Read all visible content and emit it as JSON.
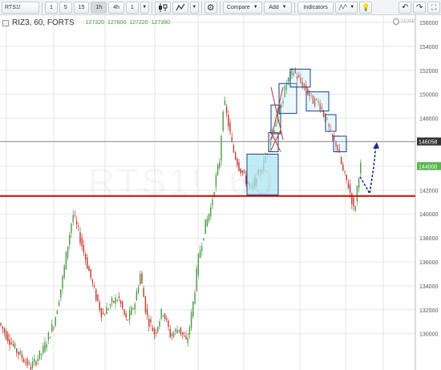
{
  "toolbar": {
    "symbol": "RTS1!",
    "intervals": [
      "1",
      "5",
      "15",
      "1h",
      "4h",
      "1"
    ],
    "active_interval": "1h",
    "compare_label": "Compare",
    "add_label": "Add",
    "indicators_label": "Indicators"
  },
  "legend": {
    "title": "RIZ3, 60, FORTS",
    "open": "127320",
    "high": "127600",
    "low": "127220",
    "close": "127390"
  },
  "settings_text": "CLOSE",
  "watermark": "RTS1!, 60",
  "price_axis": {
    "ticks": [
      "156000",
      "154000",
      "152000",
      "150000",
      "148000",
      "146000",
      "144000",
      "142000",
      "140000",
      "138000",
      "136000",
      "134000",
      "132000",
      "130000"
    ],
    "current_price_label": "144000",
    "line_price_label": "146058"
  },
  "colors": {
    "up_candle": "#4a9a43",
    "down_candle": "#c0392b",
    "support_line": "#d40000",
    "box_fill": "#aee6f2",
    "box_border": "#1e3c8c",
    "current_price_bg": "#5bb450",
    "line_price_bg": "#333333"
  },
  "chart_data": {
    "type": "candlestick",
    "title": "RIZ3, 60, FORTS",
    "ylim": [
      129000,
      157500
    ],
    "support_level": 141500,
    "horizontal_line": 146058,
    "last_price": 144000,
    "path": [
      {
        "x": 0,
        "price": 131000
      },
      {
        "x": 20,
        "price": 128800
      },
      {
        "x": 40,
        "price": 127200
      },
      {
        "x": 55,
        "price": 128500
      },
      {
        "x": 70,
        "price": 131000
      },
      {
        "x": 80,
        "price": 134500
      },
      {
        "x": 88,
        "price": 138000
      },
      {
        "x": 93,
        "price": 140000
      },
      {
        "x": 100,
        "price": 138500
      },
      {
        "x": 110,
        "price": 136000
      },
      {
        "x": 120,
        "price": 133500
      },
      {
        "x": 130,
        "price": 131500
      },
      {
        "x": 140,
        "price": 132500
      },
      {
        "x": 150,
        "price": 133000
      },
      {
        "x": 160,
        "price": 131000
      },
      {
        "x": 170,
        "price": 132500
      },
      {
        "x": 177,
        "price": 135000
      },
      {
        "x": 185,
        "price": 131500
      },
      {
        "x": 195,
        "price": 130000
      },
      {
        "x": 205,
        "price": 132000
      },
      {
        "x": 215,
        "price": 129800
      },
      {
        "x": 225,
        "price": 130500
      },
      {
        "x": 235,
        "price": 129200
      },
      {
        "x": 242,
        "price": 132000
      },
      {
        "x": 250,
        "price": 136500
      },
      {
        "x": 258,
        "price": 139000
      },
      {
        "x": 265,
        "price": 140500
      },
      {
        "x": 270,
        "price": 142500
      },
      {
        "x": 276,
        "price": 144500
      },
      {
        "x": 281,
        "price": 149600
      },
      {
        "x": 287,
        "price": 147500
      },
      {
        "x": 292,
        "price": 145500
      },
      {
        "x": 300,
        "price": 144000
      },
      {
        "x": 308,
        "price": 143000
      },
      {
        "x": 315,
        "price": 142000
      },
      {
        "x": 322,
        "price": 143000
      },
      {
        "x": 330,
        "price": 144000
      },
      {
        "x": 338,
        "price": 146000
      },
      {
        "x": 345,
        "price": 147500
      },
      {
        "x": 352,
        "price": 149000
      },
      {
        "x": 360,
        "price": 151000
      },
      {
        "x": 368,
        "price": 152000
      },
      {
        "x": 375,
        "price": 151200
      },
      {
        "x": 383,
        "price": 150500
      },
      {
        "x": 392,
        "price": 149500
      },
      {
        "x": 400,
        "price": 149300
      },
      {
        "x": 408,
        "price": 148000
      },
      {
        "x": 415,
        "price": 146500
      },
      {
        "x": 422,
        "price": 145800
      },
      {
        "x": 430,
        "price": 143500
      },
      {
        "x": 436,
        "price": 142500
      },
      {
        "x": 441,
        "price": 141200
      },
      {
        "x": 444,
        "price": 140000
      },
      {
        "x": 448,
        "price": 142500
      },
      {
        "x": 451,
        "price": 144000
      }
    ],
    "boxes": [
      {
        "x0": 308,
        "x1": 347,
        "p_top": 145000,
        "p_bottom": 141600,
        "filled": true
      },
      {
        "x0": 335,
        "x1": 347,
        "p_top": 146800,
        "p_bottom": 145200,
        "filled": false
      },
      {
        "x0": 338,
        "x1": 350,
        "p_top": 149100,
        "p_bottom": 146700,
        "filled": false
      },
      {
        "x0": 348,
        "x1": 370,
        "p_top": 150900,
        "p_bottom": 148400,
        "filled": false
      },
      {
        "x0": 362,
        "x1": 387,
        "p_top": 152100,
        "p_bottom": 150600,
        "filled": false
      },
      {
        "x0": 382,
        "x1": 410,
        "p_top": 150200,
        "p_bottom": 148600,
        "filled": false
      },
      {
        "x0": 406,
        "x1": 419,
        "p_top": 148300,
        "p_bottom": 146900,
        "filled": false
      },
      {
        "x0": 416,
        "x1": 432,
        "p_top": 146500,
        "p_bottom": 145200,
        "filled": false
      }
    ],
    "forecast_path": [
      {
        "x": 449,
        "price": 143100
      },
      {
        "x": 457,
        "price": 142200
      },
      {
        "x": 461,
        "price": 141700
      },
      {
        "x": 466,
        "price": 143900
      },
      {
        "x": 469,
        "price": 145800
      }
    ]
  }
}
